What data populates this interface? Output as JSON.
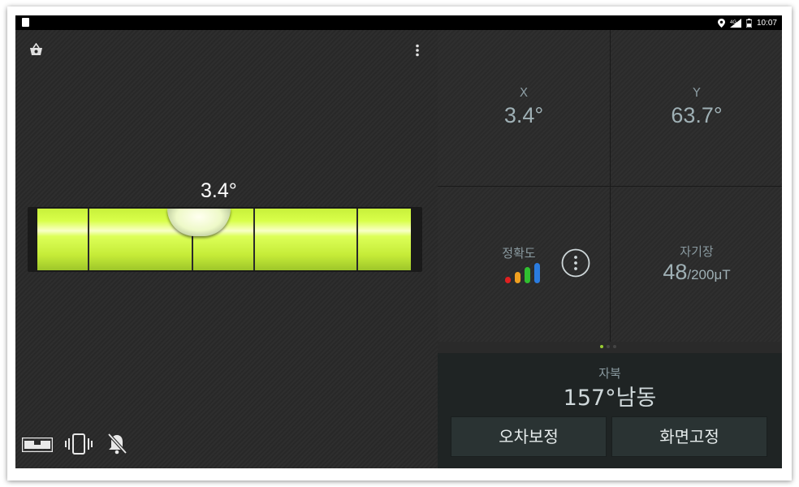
{
  "status_bar": {
    "time": "10:07"
  },
  "level": {
    "angle_label": "3.4°"
  },
  "sensor": {
    "x_label": "X",
    "x_value": "3.4°",
    "y_label": "Y",
    "y_value": "63.7°",
    "accuracy_label": "정확도",
    "magnetic_label": "자기장",
    "magnetic_value": "48",
    "magnetic_unit": "/200μT"
  },
  "compass": {
    "label": "자북",
    "value": "157°남동"
  },
  "buttons": {
    "calibrate": "오차보정",
    "screen_lock": "화면고정"
  },
  "accuracy_bar_colors": [
    "#e02020",
    "#f0a020",
    "#30c030",
    "#2a7ce0"
  ],
  "page_indicator": {
    "count": 3,
    "active": 0,
    "active_color": "#9acd32"
  },
  "icons": {
    "shop": "shopping-basket-icon",
    "menu": "overflow-menu-icon",
    "info": "more-options-icon",
    "mode": "level-mode-icon",
    "vibrate": "vibrate-icon",
    "sound": "notifications-off-icon"
  }
}
